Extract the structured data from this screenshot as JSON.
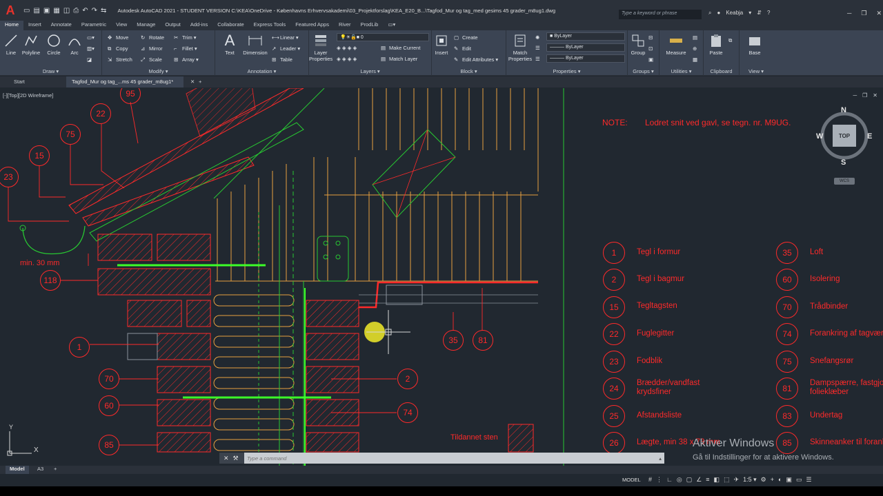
{
  "titlebar": {
    "app_logo": "A",
    "title": "Autodesk AutoCAD 2021 - STUDENT VERSION   C:\\KEA\\OneDrive - Københavns Erhvervsakademi\\03_Projektforslag\\KEA_E20_B...\\Tagfod_Mur og tag_med gesims 45 grader_m8ug1.dwg",
    "search_placeholder": "Type a keyword or phrase",
    "user": "Keabja"
  },
  "ribbon_tabs": [
    "Home",
    "Insert",
    "Annotate",
    "Parametric",
    "View",
    "Manage",
    "Output",
    "Add-ins",
    "Collaborate",
    "Express Tools",
    "Featured Apps",
    "River",
    "ProdLib"
  ],
  "ribbon": {
    "draw": {
      "title": "Draw ▾",
      "tools": [
        "Line",
        "Polyline",
        "Circle",
        "Arc"
      ]
    },
    "modify": {
      "title": "Modify ▾",
      "tools": [
        "Move",
        "Rotate",
        "Trim ▾",
        "Copy",
        "Mirror",
        "Fillet ▾",
        "Stretch",
        "Scale",
        "Array ▾"
      ]
    },
    "annotation": {
      "title": "Annotation ▾",
      "text": "Text",
      "dimension": "Dimension",
      "linear": "Linear ▾",
      "leader": "Leader ▾",
      "table": "Table"
    },
    "layers": {
      "title": "Layers ▾",
      "layer_properties": "Layer Properties",
      "current_layer": "0",
      "make_current": "Make Current",
      "match_layer": "Match Layer"
    },
    "block": {
      "title": "Block ▾",
      "insert": "Insert",
      "create": "Create",
      "edit": "Edit",
      "edit_attributes": "Edit Attributes ▾"
    },
    "properties": {
      "title": "Properties ▾",
      "match": "Match Properties",
      "color": "ByLayer",
      "linetype": "ByLayer",
      "lineweight": "ByLayer"
    },
    "groups": {
      "title": "Groups ▾",
      "group": "Group"
    },
    "utilities": {
      "title": "Utilities ▾",
      "measure": "Measure"
    },
    "clipboard": {
      "title": "Clipboard",
      "paste": "Paste"
    },
    "view": {
      "title": "View ▾",
      "base": "Base"
    }
  },
  "doc_tabs": {
    "start": "Start",
    "active": "Tagfod_Mur og tag_...ms 45 grader_m8ug1*"
  },
  "viewport": {
    "label": "[-][Top][2D Wireframe]",
    "compass": {
      "n": "N",
      "s": "S",
      "e": "E",
      "w": "W",
      "face": "TOP"
    },
    "wcs": "WCS",
    "note_label": "NOTE:",
    "note_text": "Lodret snit ved gavl, se tegn. nr. M9UG.",
    "legend": [
      {
        "num": "1",
        "text": "Tegl i formur"
      },
      {
        "num": "2",
        "text": "Tegl i bagmur"
      },
      {
        "num": "15",
        "text": "Tegltagsten"
      },
      {
        "num": "22",
        "text": "Fuglegitter"
      },
      {
        "num": "23",
        "text": "Fodblik"
      },
      {
        "num": "24",
        "text": "Brædder/vandfast\nkrydsfiner"
      },
      {
        "num": "25",
        "text": "Afstandsliste"
      },
      {
        "num": "26",
        "text": "Lægte, min 38 x 73 mm"
      },
      {
        "num": "35",
        "text": "Loft"
      },
      {
        "num": "60",
        "text": "Isolering"
      },
      {
        "num": "70",
        "text": "Trådbinder"
      },
      {
        "num": "74",
        "text": "Forankring af tagværk"
      },
      {
        "num": "75",
        "text": "Snefangsrør"
      },
      {
        "num": "81",
        "text": "Dampspærre, fastgjort\nfolieklæber"
      },
      {
        "num": "83",
        "text": "Undertag"
      },
      {
        "num": "85",
        "text": "Skinneanker til forankring"
      }
    ],
    "bubbles": [
      "95",
      "22",
      "75",
      "15",
      "23",
      "118",
      "1",
      "70",
      "60",
      "85",
      "35",
      "81",
      "2",
      "74"
    ],
    "dim_label": "min. 30 mm",
    "tildannet": "Tildannet sten",
    "activate_title": "Aktiver Windows",
    "activate_sub": "Gå til Indstillinger for at aktivere Windows.",
    "ucs_x": "X",
    "ucs_y": "Y"
  },
  "command": {
    "placeholder": "Type a command"
  },
  "layout_tabs": [
    "Model",
    "A3"
  ],
  "status": {
    "model": "MODEL",
    "scale": "1:5 ▾"
  },
  "colors": {
    "drawing_red": "#ff2a2a",
    "drawing_green": "#28c832",
    "drawing_orange": "#e8a040",
    "bright_green": "#3cff28",
    "background": "#212830",
    "ribbon": "#3b4453"
  }
}
